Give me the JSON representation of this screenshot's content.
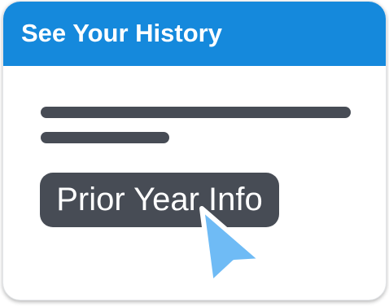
{
  "card": {
    "title": "See Your History"
  },
  "action": {
    "button_label": "Prior Year Info"
  },
  "icons": {
    "pointer": "mouse-pointer-icon"
  },
  "colors": {
    "header_background": "#1589dc",
    "header_text": "#ffffff",
    "placeholder_line": "#474c55",
    "button_background": "#474c55",
    "button_text": "#ffffff",
    "cursor_fill": "#6fbbf5"
  }
}
